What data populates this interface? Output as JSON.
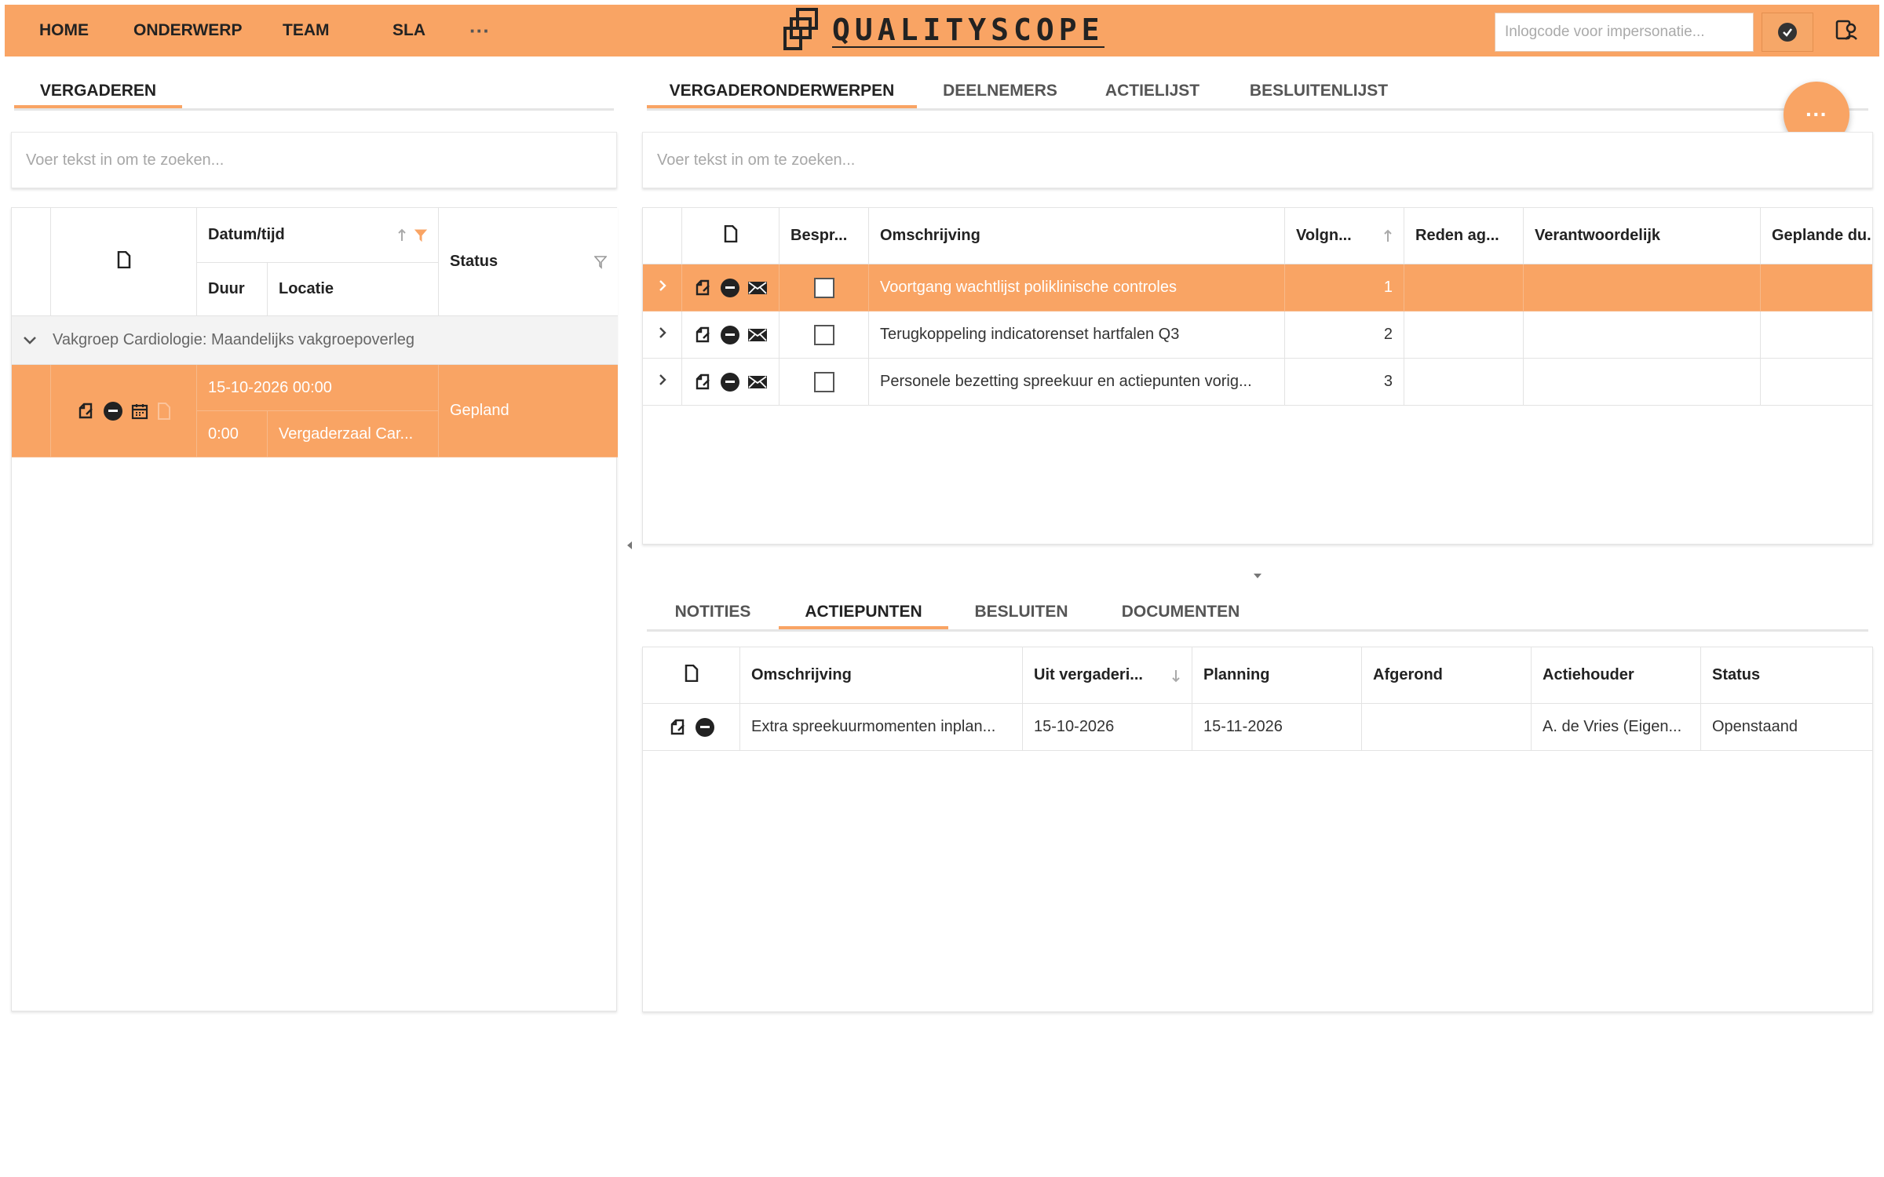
{
  "nav": {
    "items": [
      "HOME",
      "ONDERWERP",
      "TEAM",
      "SLA"
    ],
    "more": "···"
  },
  "brand": {
    "name": "QUALITYSCOPE"
  },
  "impersonation": {
    "placeholder": "Inlogcode voor impersonatie..."
  },
  "left": {
    "tab": "VERGADEREN",
    "search_placeholder": "Voer tekst in om te zoeken...",
    "headers": {
      "datetime": "Datum/tijd",
      "duration": "Duur",
      "location": "Locatie",
      "status": "Status"
    },
    "group_label": "Vakgroep Cardiologie: Maandelijks vakgroepoverleg",
    "meeting": {
      "datetime": "15-10-2026 00:00",
      "duration": "0:00",
      "location": "Vergaderzaal Car...",
      "status": "Gepland"
    }
  },
  "right": {
    "tabs": [
      "VERGADERONDERWERPEN",
      "DEELNEMERS",
      "ACTIELIJST",
      "BESLUITENLIJST"
    ],
    "search_placeholder": "Voer tekst in om te zoeken...",
    "fab_label": "···",
    "topics_headers": {
      "discussed": "Bespr...",
      "description": "Omschrijving",
      "order": "Volgn...",
      "reason": "Reden ag...",
      "responsible": "Verantwoordelijk",
      "planned": "Geplande du..."
    },
    "topics": [
      {
        "description": "Voortgang wachtlijst poliklinische controles",
        "order": "1"
      },
      {
        "description": "Terugkoppeling indicatorenset hartfalen Q3",
        "order": "2"
      },
      {
        "description": "Personele bezetting spreekuur en actiepunten vorig...",
        "order": "3"
      }
    ],
    "sub_tabs": [
      "NOTITIES",
      "ACTIEPUNTEN",
      "BESLUITEN",
      "DOCUMENTEN"
    ],
    "actions_headers": {
      "description": "Omschrijving",
      "from_meeting": "Uit vergaderi...",
      "planning": "Planning",
      "completed": "Afgerond",
      "owner": "Actiehouder",
      "status": "Status"
    },
    "actions": [
      {
        "description": "Extra spreekuurmomenten inplan...",
        "from_meeting": "15-10-2026",
        "planning": "15-11-2026",
        "completed": "",
        "owner": "A. de Vries (Eigen...",
        "status": "Openstaand"
      }
    ]
  },
  "colors": {
    "accent": "#f9a464",
    "text": "#222222"
  },
  "icons": [
    "logo-icon",
    "check-icon",
    "admin-icon",
    "document-icon",
    "sort-asc-icon",
    "sort-desc-icon",
    "filter-icon",
    "chevron-down-icon",
    "chevron-right-icon",
    "edit-icon",
    "remove-icon",
    "mail-icon",
    "calendar-icon",
    "collapse-left-icon",
    "collapse-down-icon"
  ]
}
